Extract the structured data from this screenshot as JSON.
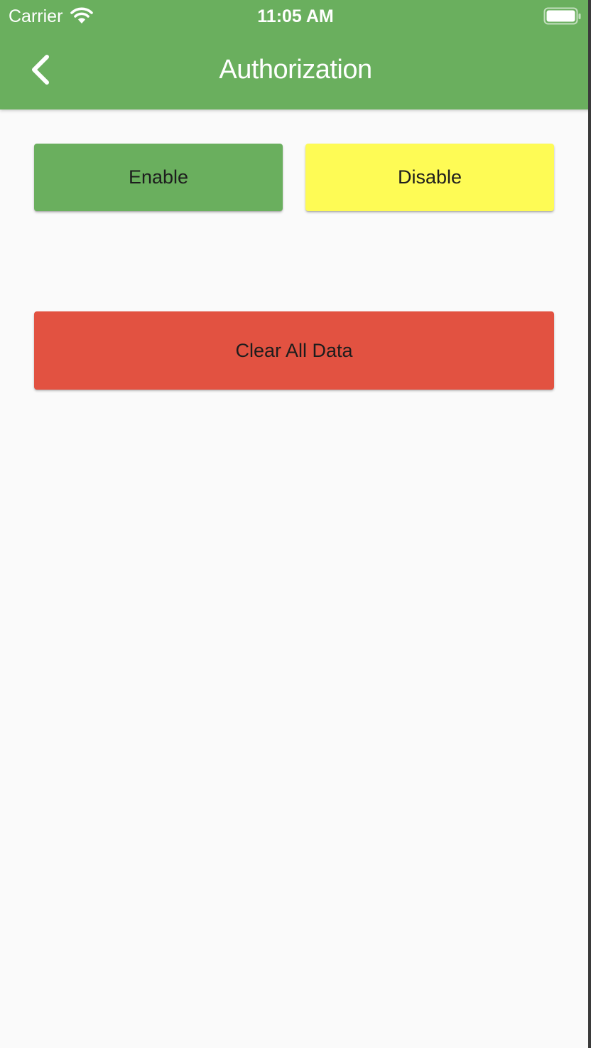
{
  "status_bar": {
    "carrier": "Carrier",
    "time": "11:05 AM",
    "wifi_icon": "wifi-icon",
    "battery_icon": "battery-icon"
  },
  "app_bar": {
    "title": "Authorization",
    "back_icon": "chevron-left-icon",
    "color": "#6aaf5e"
  },
  "actions": {
    "enable_label": "Enable",
    "disable_label": "Disable",
    "clear_label": "Clear All Data"
  },
  "colors": {
    "enable": "#6aaf5e",
    "disable": "#fefb55",
    "clear": "#e25241",
    "background": "#fafafa"
  }
}
